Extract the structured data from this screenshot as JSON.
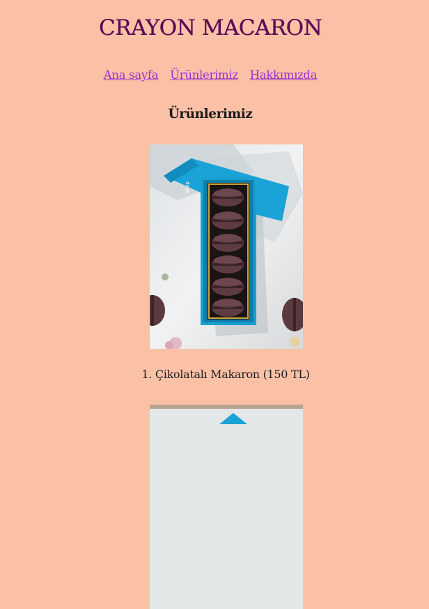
{
  "header": {
    "title": "CRAYON MACARON"
  },
  "nav": {
    "items": [
      {
        "label": "Ana sayfa"
      },
      {
        "label": "Ürünlerimiz"
      },
      {
        "label": "Hakkımızda"
      }
    ]
  },
  "main": {
    "heading": "Ürünlerimiz",
    "products": [
      {
        "caption": "1. Çikolatalı Makaron (150 TL)",
        "image_icon": "macaron-box-photo"
      },
      {
        "caption": "",
        "image_icon": "macaron-box-photo"
      }
    ]
  },
  "colors": {
    "background": "#fbc1a7",
    "title": "#5a0d55",
    "link": "#9b2fd0",
    "box": "#1aa3d6",
    "macaron": "#5e3b43"
  }
}
